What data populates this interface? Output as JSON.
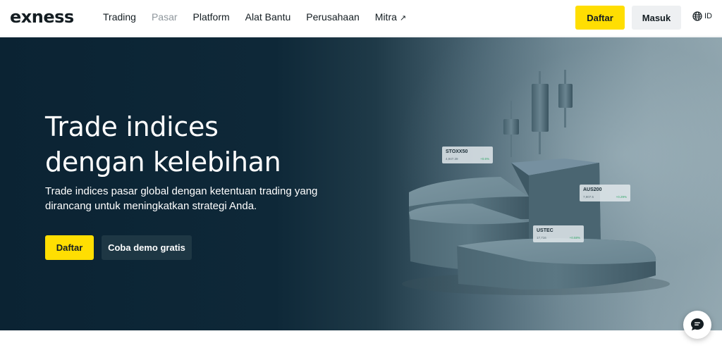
{
  "header": {
    "logo": "exness",
    "nav": [
      {
        "label": "Trading",
        "muted": false
      },
      {
        "label": "Pasar",
        "muted": true
      },
      {
        "label": "Platform",
        "muted": false
      },
      {
        "label": "Alat Bantu",
        "muted": false
      },
      {
        "label": "Perusahaan",
        "muted": false
      },
      {
        "label": "Mitra",
        "muted": false,
        "arrow": "↗"
      }
    ],
    "signup_label": "Daftar",
    "login_label": "Masuk",
    "language": "ID",
    "language_icon": "globe-icon"
  },
  "hero": {
    "title_line1": "Trade indices",
    "title_line2": "dengan kelebihan",
    "subtitle": "Trade indices pasar global dengan ketentuan trading yang dirancang untuk meningkatkan strategi Anda.",
    "primary_label": "Daftar",
    "secondary_label": "Coba demo gratis",
    "tickers": [
      {
        "name": "STOXX50",
        "value": "4,947.39",
        "change": "+0.6%"
      },
      {
        "name": "AUS200",
        "value": "7,907.5",
        "change": "+0.29%"
      },
      {
        "name": "USTEC",
        "value": "17,716",
        "change": "+0.58%"
      }
    ]
  },
  "chat": {
    "icon": "chat-icon"
  },
  "colors": {
    "accent": "#ffde02",
    "hero_dark": "#0b2333",
    "text": "#141d22"
  }
}
